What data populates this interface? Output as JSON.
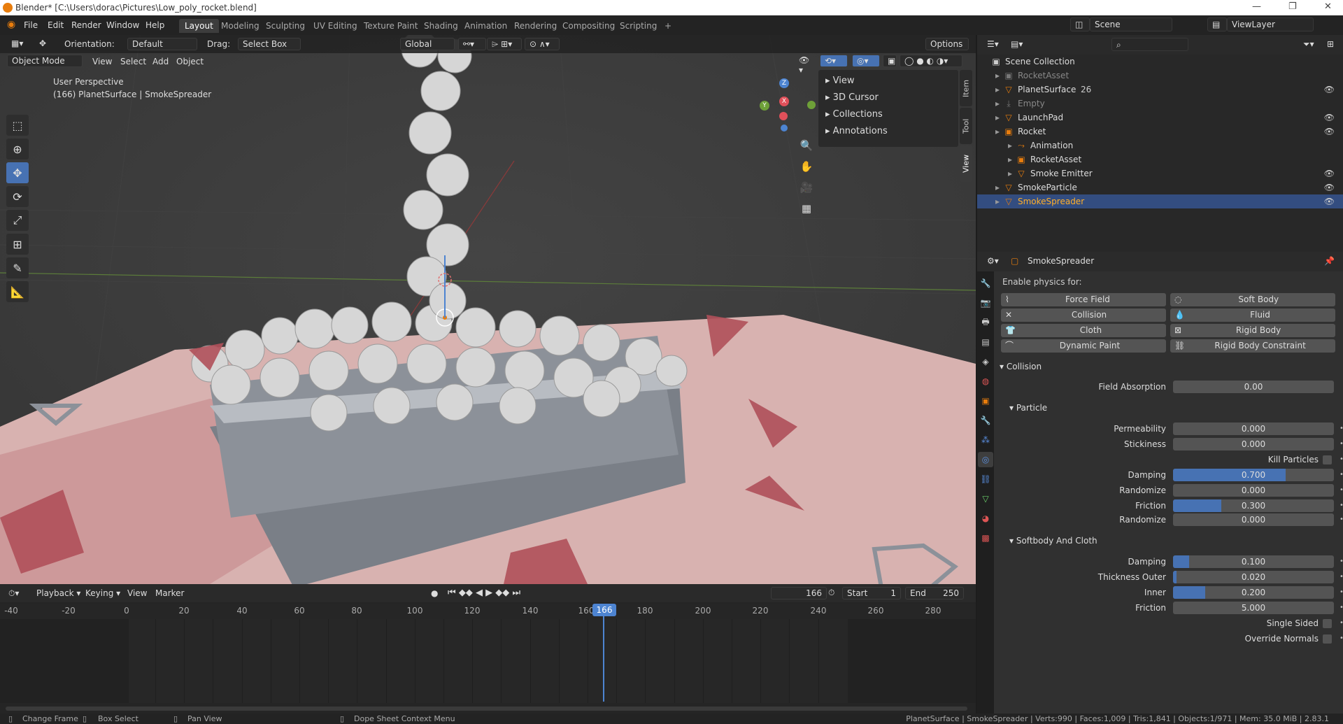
{
  "window": {
    "title": "Blender* [C:\\Users\\dorac\\Pictures\\Low_poly_rocket.blend]",
    "minimize": "—",
    "maximize": "❐",
    "close": "✕"
  },
  "menu": [
    "File",
    "Edit",
    "Render",
    "Window",
    "Help"
  ],
  "workspaces": [
    "Layout",
    "Modeling",
    "Sculpting",
    "UV Editing",
    "Texture Paint",
    "Shading",
    "Animation",
    "Rendering",
    "Compositing",
    "Scripting"
  ],
  "workspace_add": "+",
  "scene": {
    "name": "Scene",
    "view_layer": "ViewLayer"
  },
  "tool_header": {
    "orientation_label": "Orientation:",
    "orientation_value": "Default",
    "drag_label": "Drag:",
    "drag_value": "Select Box",
    "transform_orientation": "Global",
    "options": "Options"
  },
  "viewport_header": {
    "mode": "Object Mode",
    "menus": [
      "View",
      "Select",
      "Add",
      "Object"
    ]
  },
  "viewport": {
    "perspective": "User Perspective",
    "info": "(166) PlanetSurface | SmokeSpreader"
  },
  "gizmo": {
    "x": "X",
    "y": "Y",
    "z": "Z"
  },
  "n_panel": {
    "items": [
      "View",
      "3D Cursor",
      "Collections",
      "Annotations"
    ],
    "tabs": [
      "Item",
      "Tool",
      "View"
    ]
  },
  "timeline": {
    "menus": [
      "Playback",
      "Keying",
      "View",
      "Marker"
    ],
    "current_frame": "166",
    "start_label": "Start",
    "start": "1",
    "end_label": "End",
    "end": "250",
    "ticks": [
      "-40",
      "-20",
      "0",
      "20",
      "40",
      "60",
      "80",
      "100",
      "120",
      "140",
      "160",
      "180",
      "200",
      "220",
      "240",
      "260",
      "280"
    ]
  },
  "status": {
    "left": [
      "Change Frame",
      "Box Select",
      "Pan View",
      "Dope Sheet Context Menu"
    ],
    "right": "PlanetSurface | SmokeSpreader | Verts:990 | Faces:1,009 | Tris:1,841 | Objects:1/971 | Mem: 35.0 MiB | 2.83.1"
  },
  "outliner": {
    "root": "Scene Collection",
    "rows": [
      {
        "label": "RocketAsset",
        "indent": 1,
        "dim": true,
        "eye": ""
      },
      {
        "label": "PlanetSurface",
        "indent": 1,
        "dim": false,
        "eye": "👁",
        "extra": "26"
      },
      {
        "label": "Empty",
        "indent": 1,
        "dim": true,
        "eye": ""
      },
      {
        "label": "LaunchPad",
        "indent": 1,
        "dim": false,
        "eye": "👁"
      },
      {
        "label": "Rocket",
        "indent": 1,
        "dim": false,
        "eye": "👁"
      },
      {
        "label": "Animation",
        "indent": 2,
        "dim": false,
        "eye": ""
      },
      {
        "label": "RocketAsset",
        "indent": 2,
        "dim": false,
        "eye": ""
      },
      {
        "label": "Smoke Emitter",
        "indent": 2,
        "dim": false,
        "eye": "👁"
      },
      {
        "label": "SmokeParticle",
        "indent": 1,
        "dim": false,
        "eye": "👁"
      },
      {
        "label": "SmokeSpreader",
        "indent": 1,
        "dim": false,
        "eye": "👁",
        "selected": true
      }
    ]
  },
  "properties": {
    "object_name": "SmokeSpreader",
    "enable_label": "Enable physics for:",
    "physics_buttons": [
      "Force Field",
      "Soft Body",
      "Collision",
      "Fluid",
      "Cloth",
      "Rigid Body",
      "Dynamic Paint",
      "Rigid Body Constraint"
    ],
    "collision_title": "Collision",
    "field_absorption_label": "Field Absorption",
    "field_absorption": "0.00",
    "particle_title": "Particle",
    "permeability_label": "Permeability",
    "permeability": "0.000",
    "stickiness_label": "Stickiness",
    "stickiness": "0.000",
    "kill_particles_label": "Kill Particles",
    "damping_label": "Damping",
    "damping": "0.700",
    "damping_fraction": 0.7,
    "randomize_label": "Randomize",
    "randomize": "0.000",
    "friction_label": "Friction",
    "friction": "0.300",
    "friction_fraction": 0.3,
    "randomize2": "0.000",
    "softbody_title": "Softbody And Cloth",
    "sb_damping": "0.100",
    "sb_damping_fraction": 0.1,
    "thickness_outer_label": "Thickness Outer",
    "thickness_outer": "0.020",
    "thickness_outer_fraction": 0.02,
    "inner_label": "Inner",
    "inner": "0.200",
    "inner_fraction": 0.2,
    "sb_friction": "5.000",
    "single_sided_label": "Single Sided",
    "override_normals_label": "Override Normals"
  },
  "colors": {
    "accent": "#4772b3",
    "selection": "#334d80",
    "active_orange": "#e87d0d"
  }
}
